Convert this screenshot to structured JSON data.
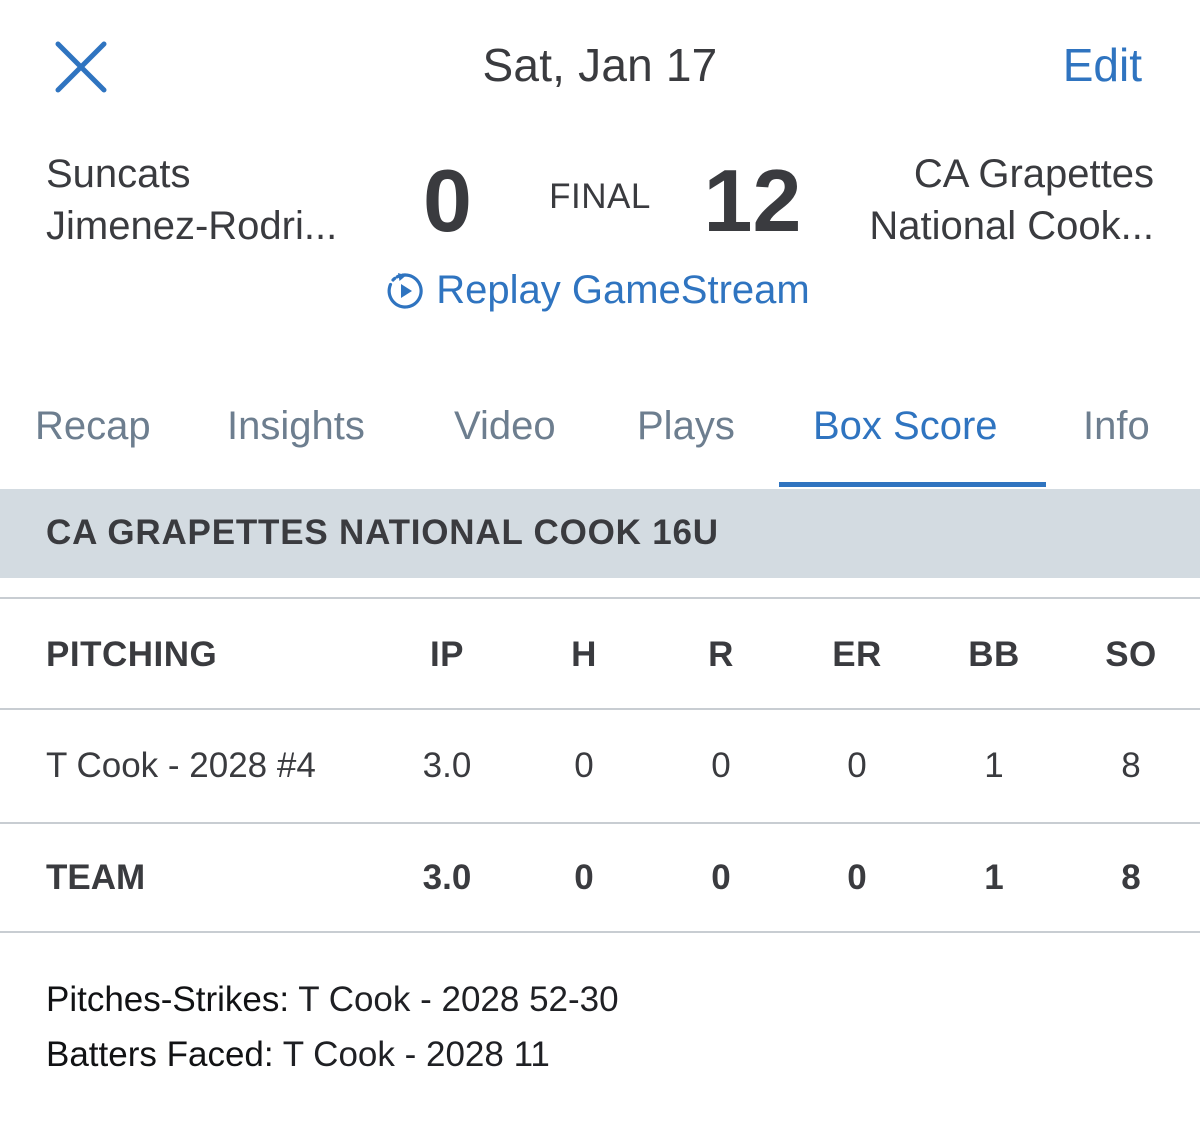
{
  "header": {
    "close_icon": "close-icon",
    "date": "Sat, Jan 17",
    "edit_label": "Edit"
  },
  "game": {
    "away_team": {
      "name": "Suncats",
      "subname": "Jimenez-Rodri...",
      "score": "0"
    },
    "home_team": {
      "name": "CA Grapettes",
      "subname": "National Cook...",
      "score": "12"
    },
    "status": "FINAL",
    "replay_label": "Replay GameStream",
    "replay_icon": "replay-play-icon"
  },
  "tabs": [
    {
      "label": "Recap",
      "active": false
    },
    {
      "label": "Insights",
      "active": false
    },
    {
      "label": "Video",
      "active": false
    },
    {
      "label": "Plays",
      "active": false
    },
    {
      "label": "Box Score",
      "active": true
    },
    {
      "label": "Info",
      "active": false
    }
  ],
  "section": {
    "title": "CA GRAPETTES NATIONAL COOK 16U"
  },
  "pitching_table": {
    "columns": [
      "PITCHING",
      "IP",
      "H",
      "R",
      "ER",
      "BB",
      "SO"
    ],
    "rows": [
      {
        "name": "T Cook - 2028 #4",
        "ip": "3.0",
        "h": "0",
        "r": "0",
        "er": "0",
        "bb": "1",
        "so": "8"
      }
    ],
    "team_total": {
      "name": "TEAM",
      "ip": "3.0",
      "h": "0",
      "r": "0",
      "er": "0",
      "bb": "1",
      "so": "8"
    }
  },
  "notes": [
    {
      "label": "Pitches-Strikes:",
      "value": " T Cook - 2028 52-30"
    },
    {
      "label": "Batters Faced:",
      "value": " T Cook - 2028 11"
    }
  ],
  "colors": {
    "accent": "#2f74c0",
    "text": "#3a3b3f",
    "tab_inactive": "#6d7e8f",
    "banner": "#d3dbe1"
  }
}
